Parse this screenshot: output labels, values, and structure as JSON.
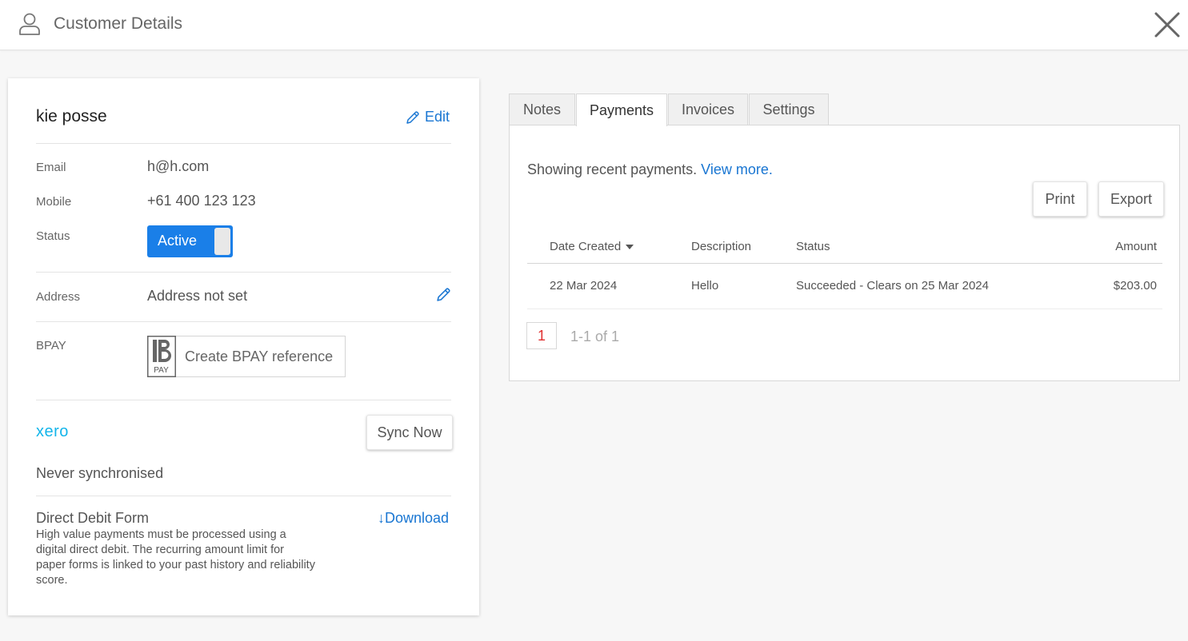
{
  "header": {
    "title": "Customer Details"
  },
  "customer": {
    "name": "kie posse",
    "edit_label": "Edit",
    "email_label": "Email",
    "email": "h@h.com",
    "mobile_label": "Mobile",
    "mobile": "+61 400 123 123",
    "status_label": "Status",
    "status_value": "Active",
    "address_label": "Address",
    "address": "Address not set",
    "bpay_label": "BPAY",
    "bpay_logo_text": "PAY",
    "bpay_action": "Create BPAY reference",
    "xero_logo": "xero",
    "sync_button": "Sync Now",
    "sync_status": "Never synchronised",
    "dd_title": "Direct Debit Form",
    "dd_description": "High value payments must be processed using a digital direct debit. The recurring amount limit for paper forms is linked to your past history and reliability score.",
    "download_label": "Download"
  },
  "tabs": [
    {
      "label": "Notes",
      "active": false
    },
    {
      "label": "Payments",
      "active": true
    },
    {
      "label": "Invoices",
      "active": false
    },
    {
      "label": "Settings",
      "active": false
    }
  ],
  "payments": {
    "showing_text": "Showing recent payments.",
    "view_more": "View more.",
    "print_button": "Print",
    "export_button": "Export",
    "columns": {
      "date": "Date Created",
      "description": "Description",
      "status": "Status",
      "amount": "Amount"
    },
    "rows": [
      {
        "date": "22 Mar 2024",
        "description": "Hello",
        "status": "Succeeded - Clears on 25 Mar 2024",
        "amount": "$203.00"
      }
    ],
    "current_page": "1",
    "page_info": "1-1 of 1"
  },
  "colors": {
    "accent": "#1976d2",
    "toggle_active": "#1a7fe8",
    "xero": "#13b5ea",
    "page_number": "#e03030"
  },
  "icons": [
    "user-icon",
    "close-icon",
    "pencil-icon",
    "bpay-logo",
    "download-icon",
    "sort-caret-icon"
  ]
}
